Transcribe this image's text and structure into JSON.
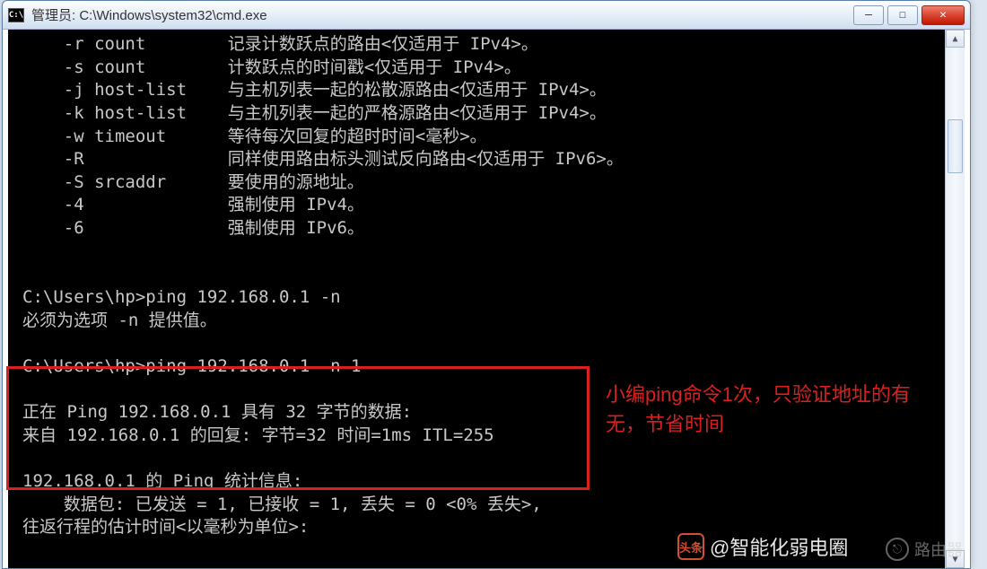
{
  "window": {
    "icon_text": "C:\\",
    "title": "管理员: C:\\Windows\\system32\\cmd.exe"
  },
  "buttons": {
    "minimize": "—",
    "maximize": "☐",
    "close": "✕"
  },
  "scrollbar": {
    "up": "▲",
    "down": "▼"
  },
  "terminal_lines": [
    "    -r count        记录计数跃点的路由<仅适用于 IPv4>。",
    "    -s count        计数跃点的时间戳<仅适用于 IPv4>。",
    "    -j host-list    与主机列表一起的松散源路由<仅适用于 IPv4>。",
    "    -k host-list    与主机列表一起的严格源路由<仅适用于 IPv4>。",
    "    -w timeout      等待每次回复的超时时间<毫秒>。",
    "    -R              同样使用路由标头测试反向路由<仅适用于 IPv6>。",
    "    -S srcaddr      要使用的源地址。",
    "    -4              强制使用 IPv4。",
    "    -6              强制使用 IPv6。",
    "",
    "",
    "C:\\Users\\hp>ping 192.168.0.1 -n",
    "必须为选项 -n 提供值。",
    "",
    "C:\\Users\\hp>ping 192.168.0.1 -n 1",
    "",
    "正在 Ping 192.168.0.1 具有 32 字节的数据:",
    "来自 192.168.0.1 的回复: 字节=32 时间=1ms ITL=255",
    "",
    "192.168.0.1 的 Ping 统计信息:",
    "    数据包: 已发送 = 1, 已接收 = 1, 丢失 = 0 <0% 丢失>,",
    "往返行程的估计时间<以毫秒为单位>:"
  ],
  "annotation": "小编ping命令1次，只验证地址的有无，节省时间",
  "watermark": {
    "icon": "头条",
    "text": "@智能化弱电圈"
  },
  "router_wm": {
    "icon": "⎋",
    "text": "路由器"
  }
}
